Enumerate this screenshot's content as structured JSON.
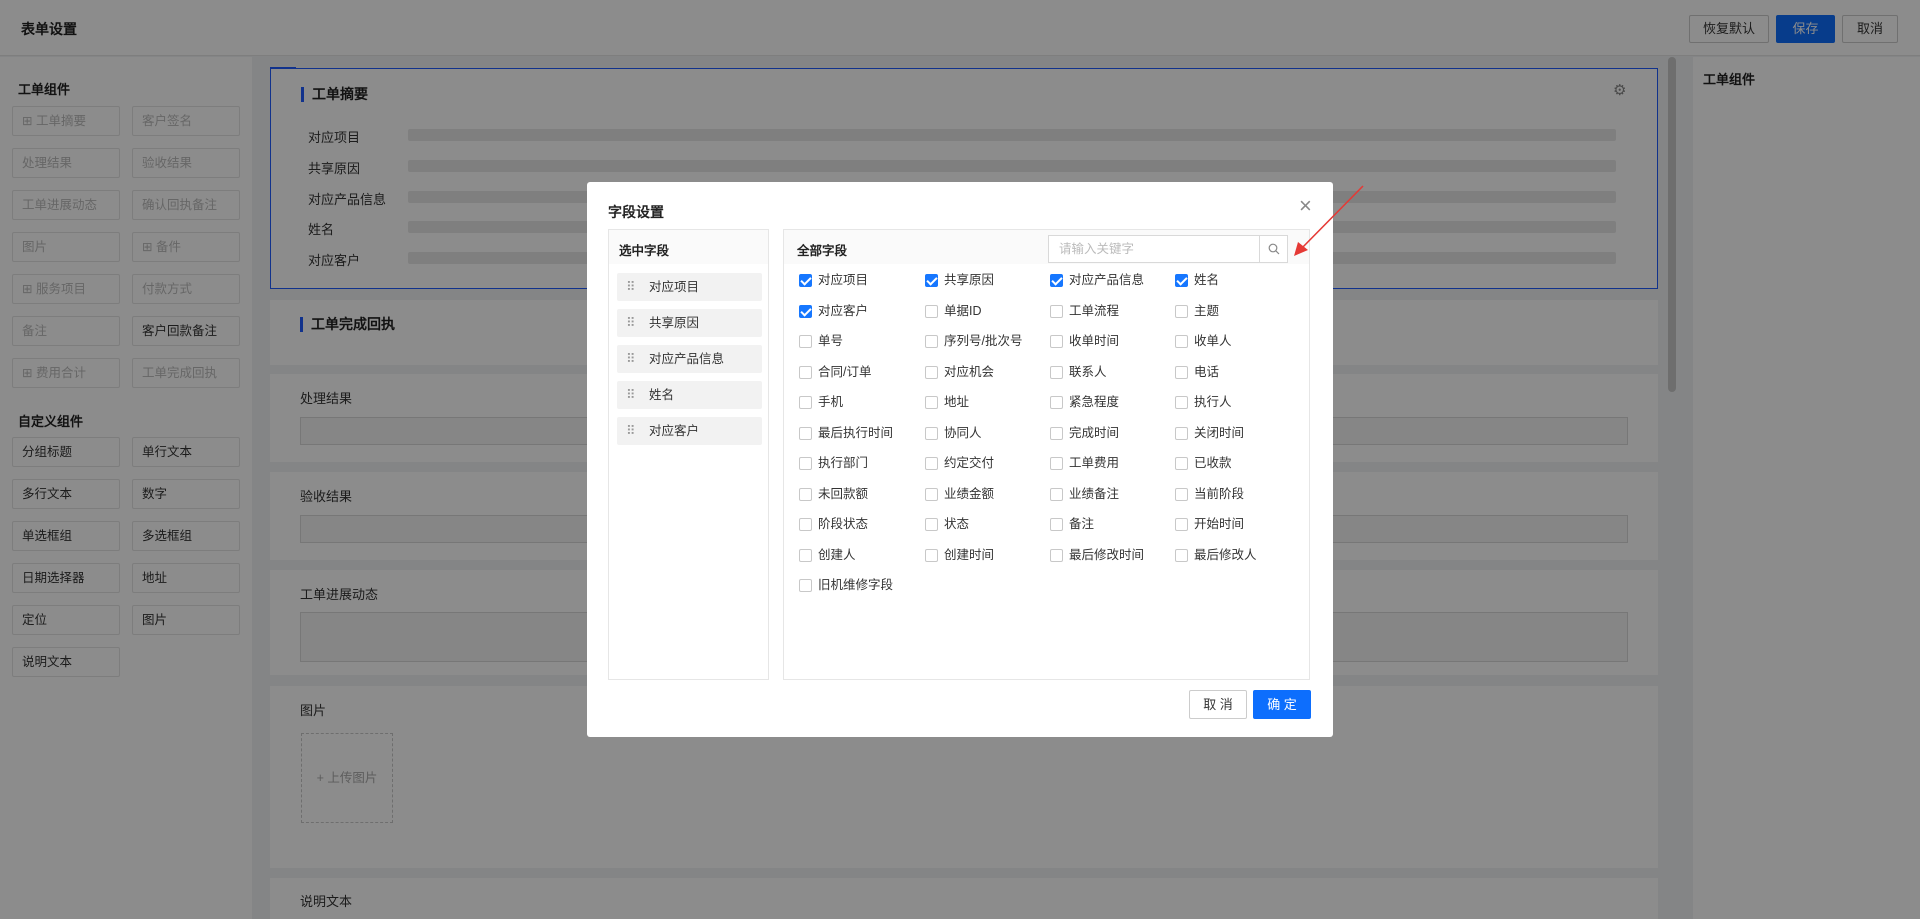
{
  "header": {
    "title": "表单设置",
    "restore_label": "恢复默认",
    "save_label": "保存",
    "cancel_label": "取消"
  },
  "left_sidebar": {
    "components_title": "工单组件",
    "components": [
      {
        "label": "⊞ 工单摘要",
        "active": false
      },
      {
        "label": "客户签名",
        "active": false
      },
      {
        "label": "处理结果",
        "active": false
      },
      {
        "label": "验收结果",
        "active": false
      },
      {
        "label": "工单进展动态",
        "active": false
      },
      {
        "label": "确认回执备注",
        "active": false
      },
      {
        "label": "图片",
        "active": false
      },
      {
        "label": "⊞ 备件",
        "active": false
      },
      {
        "label": "⊞ 服务项目",
        "active": false
      },
      {
        "label": "付款方式",
        "active": false
      },
      {
        "label": "备注",
        "active": false
      },
      {
        "label": "客户回款备注",
        "active": true
      },
      {
        "label": "⊞ 费用合计",
        "active": false
      },
      {
        "label": "工单完成回执",
        "active": false
      }
    ],
    "custom_title": "自定义组件",
    "custom": [
      "分组标题",
      "单行文本",
      "多行文本",
      "数字",
      "单选框组",
      "多选框组",
      "日期选择器",
      "地址",
      "定位",
      "图片",
      "说明文本"
    ]
  },
  "center": {
    "summary_card": {
      "title": "工单摘要",
      "rows": [
        "对应项目",
        "共享原因",
        "对应产品信息",
        "姓名",
        "对应客户"
      ]
    },
    "receipt_card_title": "工单完成回执",
    "fields": {
      "process_result": "处理结果",
      "accept_result": "验收结果",
      "progress": "工单进展动态",
      "images": "图片",
      "upload_label": "+ 上传图片",
      "desc_text": "说明文本"
    }
  },
  "right_panel": {
    "title": "工单组件"
  },
  "modal": {
    "title": "字段设置",
    "selected_header": "选中字段",
    "selected": [
      "对应项目",
      "共享原因",
      "对应产品信息",
      "姓名",
      "对应客户"
    ],
    "all_header": "全部字段",
    "search_placeholder": "请输入关键字",
    "fields": [
      {
        "label": "对应项目",
        "checked": true
      },
      {
        "label": "共享原因",
        "checked": true
      },
      {
        "label": "对应产品信息",
        "checked": true
      },
      {
        "label": "姓名",
        "checked": true
      },
      {
        "label": "对应客户",
        "checked": true
      },
      {
        "label": "单据ID",
        "checked": false
      },
      {
        "label": "工单流程",
        "checked": false
      },
      {
        "label": "主题",
        "checked": false
      },
      {
        "label": "单号",
        "checked": false
      },
      {
        "label": "序列号/批次号",
        "checked": false
      },
      {
        "label": "收单时间",
        "checked": false
      },
      {
        "label": "收单人",
        "checked": false
      },
      {
        "label": "合同/订单",
        "checked": false
      },
      {
        "label": "对应机会",
        "checked": false
      },
      {
        "label": "联系人",
        "checked": false
      },
      {
        "label": "电话",
        "checked": false
      },
      {
        "label": "手机",
        "checked": false
      },
      {
        "label": "地址",
        "checked": false
      },
      {
        "label": "紧急程度",
        "checked": false
      },
      {
        "label": "执行人",
        "checked": false
      },
      {
        "label": "最后执行时间",
        "checked": false
      },
      {
        "label": "协同人",
        "checked": false
      },
      {
        "label": "完成时间",
        "checked": false
      },
      {
        "label": "关闭时间",
        "checked": false
      },
      {
        "label": "执行部门",
        "checked": false
      },
      {
        "label": "约定交付",
        "checked": false
      },
      {
        "label": "工单费用",
        "checked": false
      },
      {
        "label": "已收款",
        "checked": false
      },
      {
        "label": "未回款额",
        "checked": false
      },
      {
        "label": "业绩金额",
        "checked": false
      },
      {
        "label": "业绩备注",
        "checked": false
      },
      {
        "label": "当前阶段",
        "checked": false
      },
      {
        "label": "阶段状态",
        "checked": false
      },
      {
        "label": "状态",
        "checked": false
      },
      {
        "label": "备注",
        "checked": false
      },
      {
        "label": "开始时间",
        "checked": false
      },
      {
        "label": "创建人",
        "checked": false
      },
      {
        "label": "创建时间",
        "checked": false
      },
      {
        "label": "最后修改时间",
        "checked": false
      },
      {
        "label": "最后修改人",
        "checked": false
      },
      {
        "label": "旧机维修字段",
        "checked": false
      }
    ],
    "cancel_label": "取 消",
    "confirm_label": "确 定"
  },
  "colors": {
    "primary": "#0d6efd",
    "annotation_arrow": "#e53935"
  }
}
